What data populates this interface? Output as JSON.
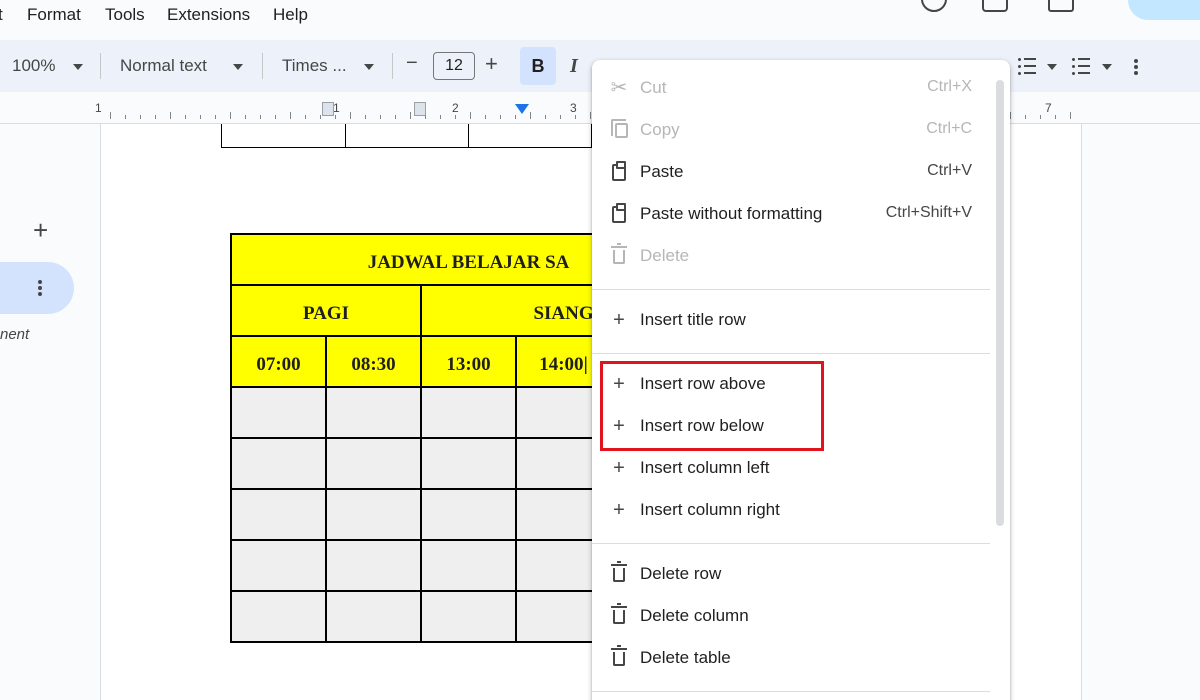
{
  "menu_bar": {
    "items": [
      "t",
      "Format",
      "Tools",
      "Extensions",
      "Help"
    ]
  },
  "toolbar": {
    "zoom": "100%",
    "style": "Normal text",
    "font": "Times ...",
    "decrease": "−",
    "font_size": "12",
    "increase": "+",
    "bold": "B",
    "italic": "I",
    "more": "more-vert-icon"
  },
  "ruler": {
    "numbers": [
      "1",
      "1",
      "2",
      "3",
      "7"
    ]
  },
  "sidebar": {
    "add": "+",
    "partial_text": "nent"
  },
  "table": {
    "title": "JADWAL BELAJAR SA",
    "sessions": [
      "PAGI",
      "SIANG"
    ],
    "times": [
      "07:00",
      "08:30",
      "13:00",
      "14:00"
    ],
    "empty_rows": 5
  },
  "context_menu": {
    "items": [
      {
        "icon": "scissors-icon",
        "label": "Cut",
        "shortcut": "Ctrl+X",
        "disabled": true
      },
      {
        "icon": "copy-icon",
        "label": "Copy",
        "shortcut": "Ctrl+C",
        "disabled": true
      },
      {
        "icon": "clipboard-icon",
        "label": "Paste",
        "shortcut": "Ctrl+V",
        "disabled": false
      },
      {
        "icon": "clipboard-format-icon",
        "label": "Paste without formatting",
        "shortcut": "Ctrl+Shift+V",
        "disabled": false
      },
      {
        "icon": "trash-icon",
        "label": "Delete",
        "shortcut": "",
        "disabled": true
      },
      {
        "icon": "plus-icon",
        "label": "Insert title row",
        "shortcut": "",
        "disabled": false
      },
      {
        "icon": "plus-icon",
        "label": "Insert row above",
        "shortcut": "",
        "disabled": false
      },
      {
        "icon": "plus-icon",
        "label": "Insert row below",
        "shortcut": "",
        "disabled": false
      },
      {
        "icon": "plus-icon",
        "label": "Insert column left",
        "shortcut": "",
        "disabled": false
      },
      {
        "icon": "plus-icon",
        "label": "Insert column right",
        "shortcut": "",
        "disabled": false
      },
      {
        "icon": "trash-icon",
        "label": "Delete row",
        "shortcut": "",
        "disabled": false
      },
      {
        "icon": "trash-icon",
        "label": "Delete column",
        "shortcut": "",
        "disabled": false
      },
      {
        "icon": "trash-icon",
        "label": "Delete table",
        "shortcut": "",
        "disabled": false
      }
    ]
  },
  "colors": {
    "table_header": "#ffff00",
    "highlight_box": "#e1141e",
    "bold_active": "#d3e3fd"
  }
}
